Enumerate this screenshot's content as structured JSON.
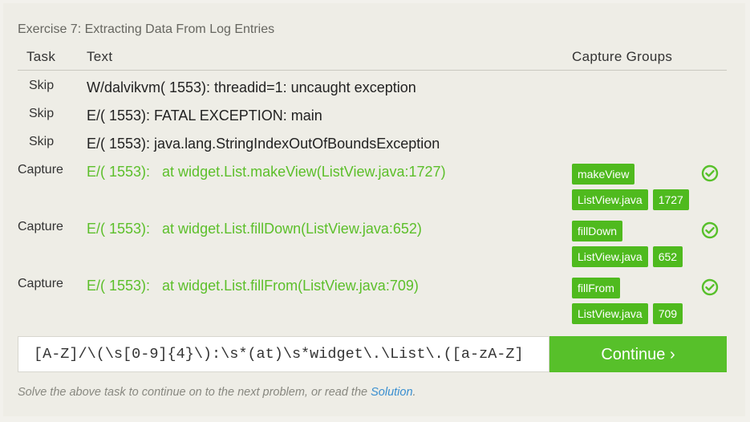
{
  "exercise": {
    "title": "Exercise 7: Extracting Data From Log Entries"
  },
  "table": {
    "headers": {
      "task": "Task",
      "text": "Text",
      "groups": "Capture Groups"
    },
    "rows": [
      {
        "task": "Skip",
        "text": "W/dalvikvm( 1553): threadid=1: uncaught exception"
      },
      {
        "task": "Skip",
        "text": "E/( 1553): FATAL EXCEPTION: main"
      },
      {
        "task": "Skip",
        "text": "E/( 1553): java.lang.StringIndexOutOfBoundsException"
      },
      {
        "task": "Capture",
        "text": "E/( 1553):   at widget.List.makeView(ListView.java:1727)",
        "groups": [
          "makeView",
          "ListView.java",
          "1727"
        ],
        "status": "check-circle-icon"
      },
      {
        "task": "Capture",
        "text": "E/( 1553):   at widget.List.fillDown(ListView.java:652)",
        "groups": [
          "fillDown",
          "ListView.java",
          "652"
        ],
        "status": "check-circle-icon"
      },
      {
        "task": "Capture",
        "text": "E/( 1553):   at widget.List.fillFrom(ListView.java:709)",
        "groups": [
          "fillFrom",
          "ListView.java",
          "709"
        ],
        "status": "check-circle-icon"
      }
    ]
  },
  "regex_input": {
    "value": "[A-Z]/\\(\\s[0-9]{4}\\):\\s*(at)\\s*widget\\.\\List\\.([a-zA-Z]"
  },
  "continue_button": {
    "label": "Continue ›"
  },
  "footer": {
    "text": "Solve the above task to continue on to the next problem, or read the ",
    "link": "Solution",
    "suffix": "."
  },
  "colors": {
    "accent": "#57c02a",
    "badge": "#4fba1e",
    "link": "#3a8fd0"
  }
}
